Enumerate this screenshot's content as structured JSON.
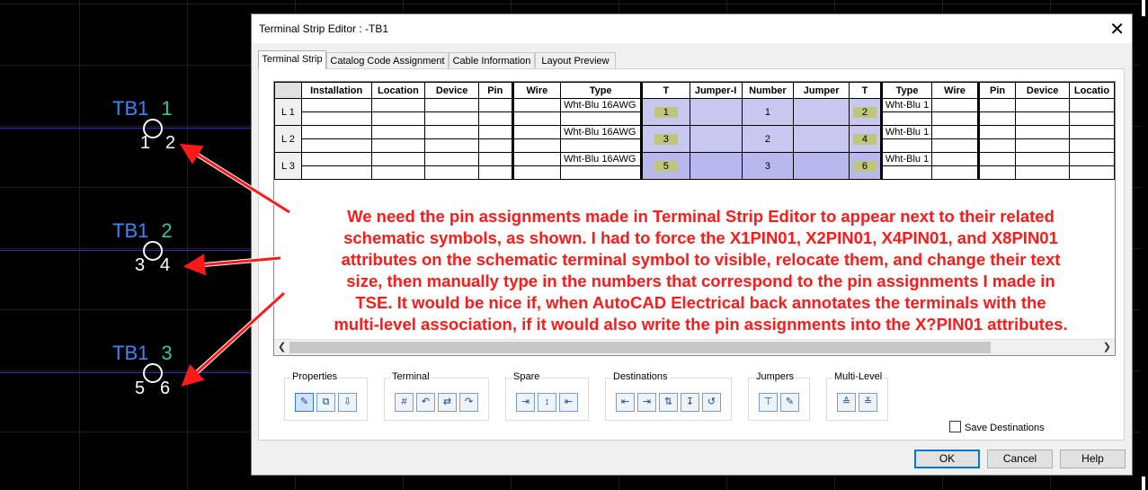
{
  "cad": {
    "terminals": [
      {
        "tag": "TB1",
        "number": "1",
        "pin_left": "1",
        "pin_right": "2"
      },
      {
        "tag": "TB1",
        "number": "2",
        "pin_left": "3",
        "pin_right": "4"
      },
      {
        "tag": "TB1",
        "number": "3",
        "pin_left": "5",
        "pin_right": "6"
      }
    ]
  },
  "dialog": {
    "title": "Terminal Strip Editor : -TB1",
    "close_glyph": "✕",
    "tabs": [
      {
        "label": "Terminal Strip",
        "active": true
      },
      {
        "label": "Catalog Code Assignment"
      },
      {
        "label": "Cable Information"
      },
      {
        "label": "Layout Preview"
      }
    ],
    "grid": {
      "headers": [
        "",
        "Installation",
        "Location",
        "Device",
        "Pin",
        "Wire",
        "Type",
        "T",
        "Jumper-I",
        "Number",
        "Jumper",
        "T",
        "Type",
        "Wire",
        "Pin",
        "Device",
        "Locatio"
      ],
      "rows": [
        {
          "level": "L 1",
          "type_left": "Wht-Blu 16AWG",
          "t_left": "1",
          "number": "1",
          "t_right": "2",
          "type_right": "Wht-Blu 1"
        },
        {
          "level": "L 2",
          "type_left": "Wht-Blu 16AWG",
          "t_left": "3",
          "number": "2",
          "t_right": "4",
          "type_right": "Wht-Blu 1"
        },
        {
          "level": "L 3",
          "type_left": "Wht-Blu 16AWG",
          "t_left": "5",
          "number": "3",
          "t_right": "6",
          "type_right": "Wht-Blu 1"
        }
      ]
    },
    "groups": [
      {
        "label": "Properties"
      },
      {
        "label": "Terminal"
      },
      {
        "label": "Spare"
      },
      {
        "label": "Destinations"
      },
      {
        "label": "Jumpers"
      },
      {
        "label": "Multi-Level"
      }
    ],
    "save_destinations_label": "Save Destinations",
    "buttons": {
      "ok": "OK",
      "cancel": "Cancel",
      "help": "Help"
    }
  },
  "annotation": {
    "lines": [
      "We need the pin assignments made in Terminal Strip Editor to appear next to their related",
      "schematic symbols, as shown. I had to force the X1PIN01, X2PIN01, X4PIN01, and X8PIN01",
      "attributes on the schematic terminal symbol to visible, relocate them, and change their text",
      "size, then manually type in the numbers that correspond to the pin assignments I made in",
      "TSE.  It would be nice if, when AutoCAD Electrical back annotates the terminals with the",
      "multi-level association, if it would also write the pin assignments into the X?PIN01 attributes."
    ],
    "color": "#ff1a1a"
  }
}
